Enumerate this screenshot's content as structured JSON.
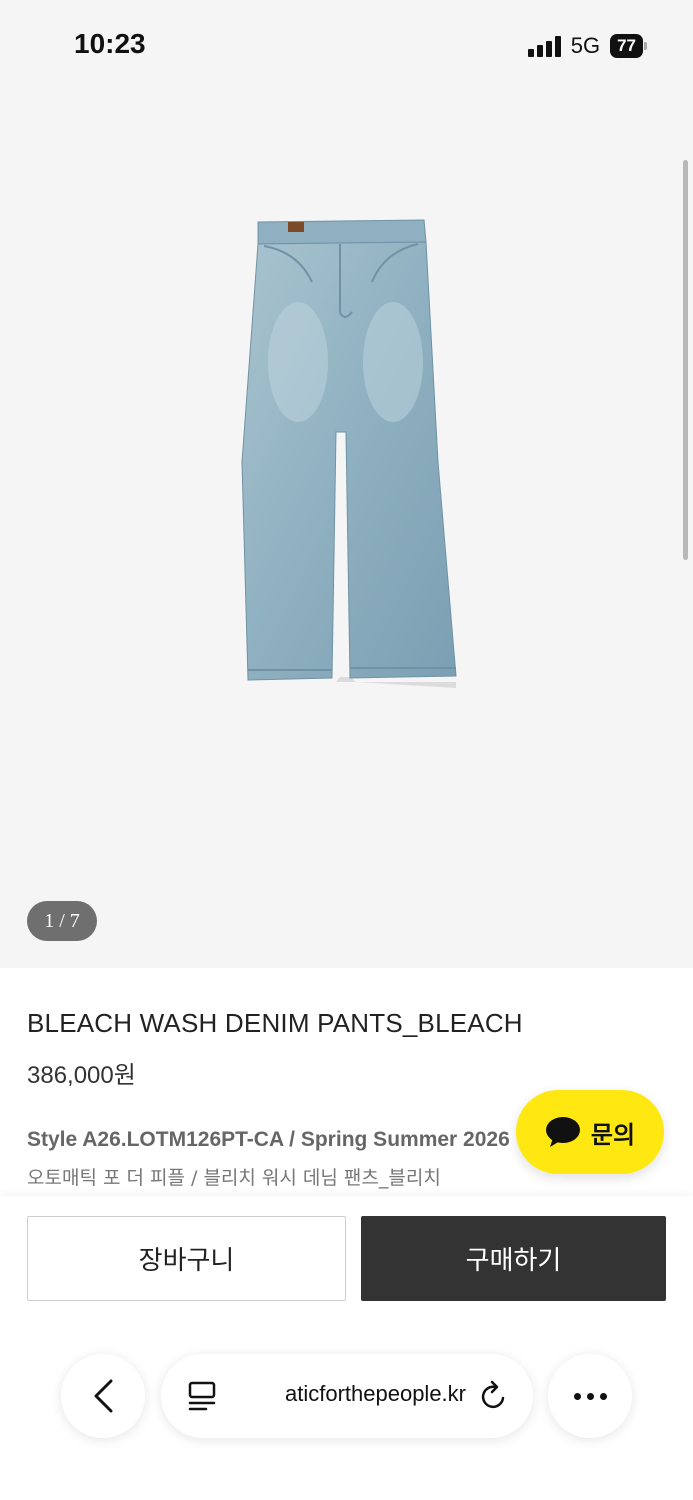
{
  "status_bar": {
    "time": "10:23",
    "network": "5G",
    "battery": "77"
  },
  "gallery": {
    "pager": "1 / 7",
    "image": "denim-pants-photo"
  },
  "product": {
    "title": "BLEACH WASH DENIM PANTS_BLEACH",
    "price": "386,000원",
    "style_line": "Style A26.LOTM126PT-CA / Spring Summer 2026",
    "korean_name": "오토매틱 포 더 피플 / 블리치 워시 데님 팬츠_블리치"
  },
  "inquiry": {
    "label": "문의",
    "icon": "chat-bubble-icon",
    "color": "#ffe812"
  },
  "actions": {
    "cart_label": "장바구니",
    "buy_label": "구매하기",
    "buy_color": "#333333"
  },
  "browser": {
    "url": "aticforthepeople.kr",
    "back_icon": "chevron-left-icon",
    "reader_icon": "reader-icon",
    "reload_icon": "reload-icon",
    "more_icon": "more-icon"
  }
}
